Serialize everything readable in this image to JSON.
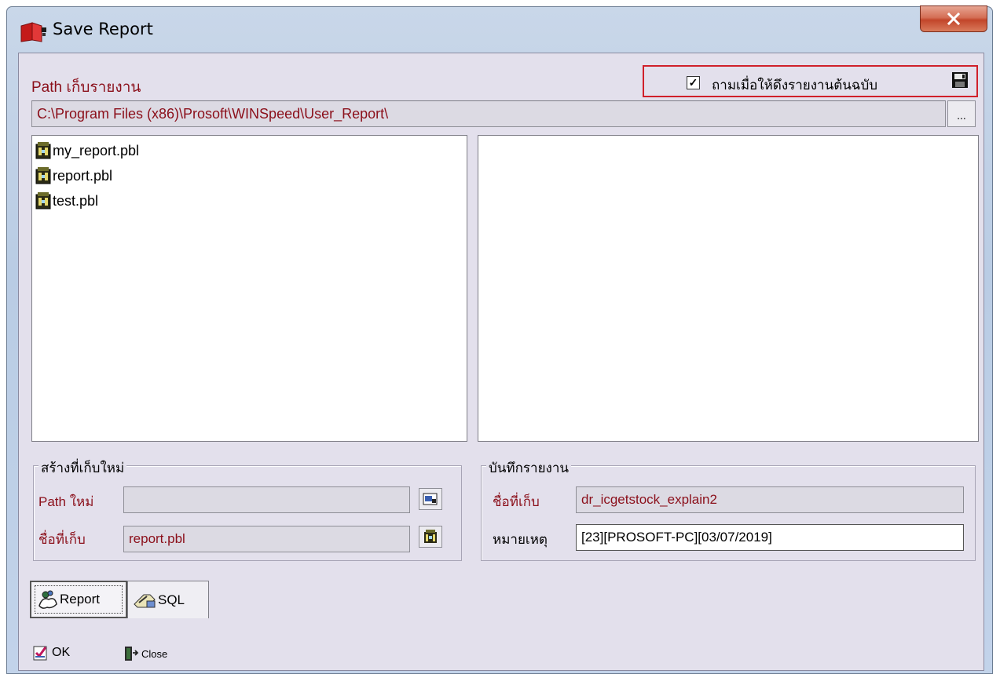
{
  "window": {
    "title": "Save Report",
    "close_label": "X"
  },
  "path_section": {
    "label": "Path เก็บรายงาน",
    "ask_checkbox_checked": true,
    "ask_checkbox_mark": "✓",
    "ask_label": "ถามเมื่อให้ดึงรายงานต้นฉบับ",
    "path_value": "C:\\Program Files (x86)\\Prosoft\\WINSpeed\\User_Report\\",
    "browse_label": "..."
  },
  "file_list": {
    "items": [
      {
        "label": "my_report.pbl"
      },
      {
        "label": "report.pbl"
      },
      {
        "label": "test.pbl"
      }
    ]
  },
  "new_location_group": {
    "title": "สร้างที่เก็บใหม่",
    "path_label": "Path ใหม่",
    "path_value": "",
    "name_label": "ชื่อที่เก็บ",
    "name_value": "report.pbl"
  },
  "save_report_group": {
    "title": "บันทึกรายงาน",
    "name_label": "ชื่อที่เก็บ",
    "name_value": "dr_icgetstock_explain2",
    "note_label": "หมายเหตุ",
    "note_value": "[23][PROSOFT-PC][03/07/2019]"
  },
  "tabs": [
    {
      "label": "Report",
      "active": true
    },
    {
      "label": "SQL",
      "active": false
    }
  ],
  "footer": {
    "ok_label": "OK",
    "close_label": "Close"
  },
  "colors": {
    "accent_text": "#8b0f1a",
    "highlight_border": "#d0202a",
    "client_bg": "#e3e0ec"
  }
}
